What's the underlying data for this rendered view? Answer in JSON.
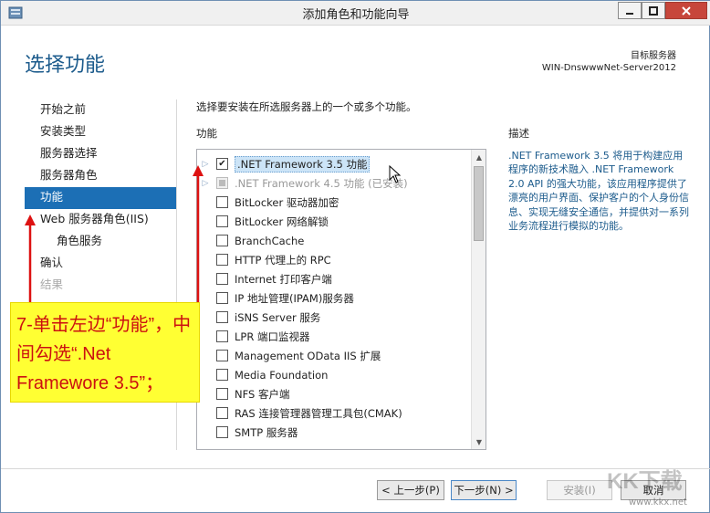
{
  "window": {
    "title": "添加角色和功能向导"
  },
  "header": {
    "page_title": "选择功能",
    "server_caption": "目标服务器",
    "server_name": "WIN-DnswwwNet-Server2012"
  },
  "nav": {
    "items": [
      {
        "label": "开始之前"
      },
      {
        "label": "安装类型"
      },
      {
        "label": "服务器选择"
      },
      {
        "label": "服务器角色"
      },
      {
        "label": "功能"
      },
      {
        "label": "Web 服务器角色(IIS)"
      },
      {
        "label": "角色服务"
      },
      {
        "label": "确认"
      },
      {
        "label": "结果"
      }
    ]
  },
  "main": {
    "instruction": "选择要安装在所选服务器上的一个或多个功能。",
    "features_label": "功能",
    "features": [
      {
        "label": ".NET Framework 3.5 功能",
        "checked": true
      },
      {
        "label": ".NET Framework 4.5 功能 (已安装)",
        "checked": "partial"
      },
      {
        "label": "BitLocker 驱动器加密",
        "checked": false
      },
      {
        "label": "BitLocker 网络解锁",
        "checked": false
      },
      {
        "label": "BranchCache",
        "checked": false
      },
      {
        "label": "HTTP 代理上的 RPC",
        "checked": false
      },
      {
        "label": "Internet 打印客户端",
        "checked": false
      },
      {
        "label": "IP 地址管理(IPAM)服务器",
        "checked": false
      },
      {
        "label": "iSNS Server 服务",
        "checked": false
      },
      {
        "label": "LPR 端口监视器",
        "checked": false
      },
      {
        "label": "Management OData IIS 扩展",
        "checked": false
      },
      {
        "label": "Media Foundation",
        "checked": false
      },
      {
        "label": "NFS 客户端",
        "checked": false
      },
      {
        "label": "RAS 连接管理器管理工具包(CMAK)",
        "checked": false
      },
      {
        "label": "SMTP 服务器",
        "checked": false
      }
    ]
  },
  "description": {
    "label": "描述",
    "text": ".NET Framework 3.5 将用于构建应用程序的新技术融入 .NET Framework 2.0 API 的强大功能，该应用程序提供了漂亮的用户界面、保护客户的个人身份信息、实现无缝安全通信，并提供对一系列业务流程进行模拟的功能。"
  },
  "footer": {
    "prev_label": "< 上一步(P)",
    "next_label": "下一步(N) >",
    "install_label": "安装(I)",
    "cancel_label": "取消"
  },
  "annotation": {
    "text": "7-单击左边“功能”，中间勾选“.Net Framewore 3.5”；"
  },
  "watermark": {
    "logo": "KK下载",
    "url": "www.kkx.net"
  },
  "colors": {
    "accent": "#1c6fb5",
    "heading": "#1c5b8c",
    "callout_bg": "#ffff33",
    "callout_text": "#cc1010",
    "close_button": "#c7463b"
  }
}
